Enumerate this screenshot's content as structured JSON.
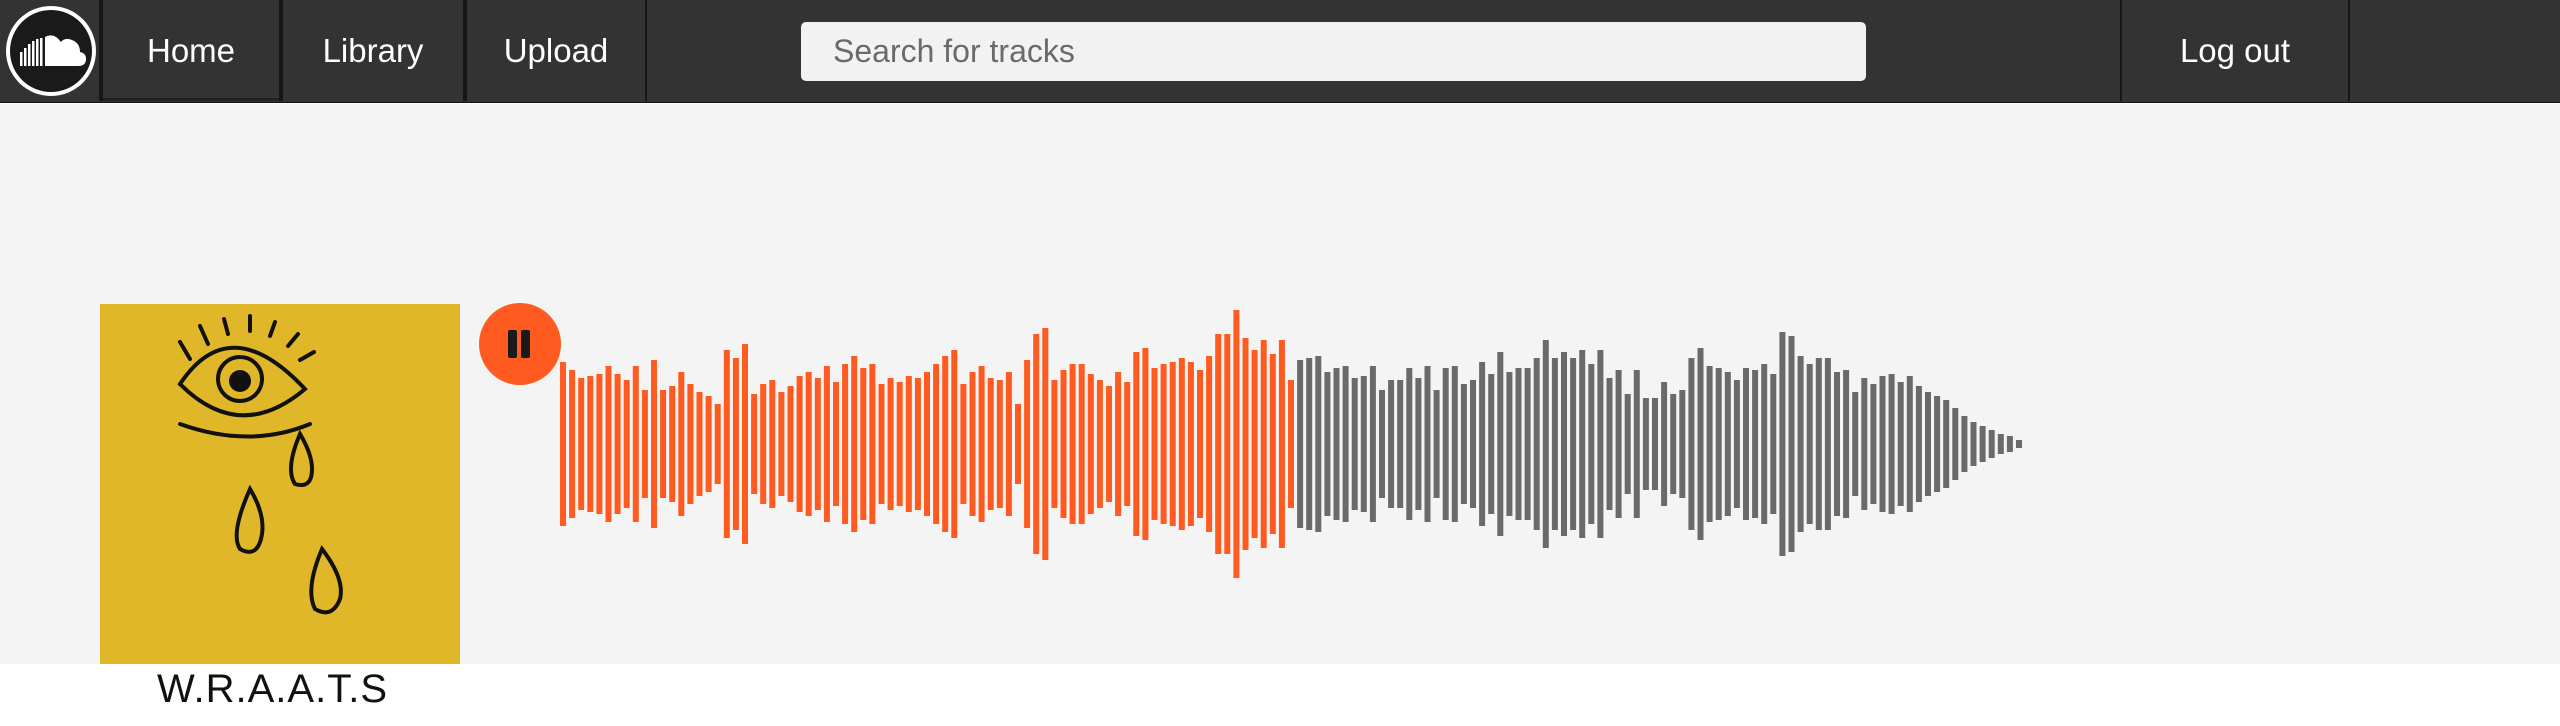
{
  "nav": {
    "logo_icon": "soundcloud-logo-icon",
    "home_label": "Home",
    "library_label": "Library",
    "upload_label": "Upload",
    "search_placeholder": "Search for tracks",
    "logout_label": "Log out"
  },
  "player": {
    "state": "playing",
    "play_button_icon": "pause-icon",
    "cover_art_icon": "crying-eye-icon",
    "track_title": "W.R.A.A.T.S",
    "progress_fraction": 0.503,
    "colors": {
      "played": "#ff5a1f",
      "unplayed": "#6a6a6a",
      "accent": "#ff5a1f",
      "navbar": "#333333"
    },
    "waveform_amplitudes": [
      0.41,
      0.37,
      0.33,
      0.34,
      0.35,
      0.39,
      0.35,
      0.32,
      0.39,
      0.27,
      0.42,
      0.27,
      0.29,
      0.36,
      0.3,
      0.26,
      0.24,
      0.2,
      0.47,
      0.43,
      0.5,
      0.25,
      0.3,
      0.32,
      0.26,
      0.29,
      0.34,
      0.36,
      0.33,
      0.39,
      0.31,
      0.4,
      0.44,
      0.38,
      0.4,
      0.3,
      0.33,
      0.31,
      0.34,
      0.33,
      0.36,
      0.4,
      0.44,
      0.47,
      0.3,
      0.36,
      0.39,
      0.33,
      0.32,
      0.36,
      0.2,
      0.42,
      0.55,
      0.58,
      0.32,
      0.37,
      0.4,
      0.4,
      0.35,
      0.32,
      0.29,
      0.36,
      0.31,
      0.46,
      0.48,
      0.38,
      0.4,
      0.41,
      0.43,
      0.41,
      0.37,
      0.44,
      0.55,
      0.55,
      0.67,
      0.53,
      0.47,
      0.52,
      0.45,
      0.52,
      0.32,
      0.42,
      0.43,
      0.44,
      0.36,
      0.38,
      0.39,
      0.33,
      0.34,
      0.39,
      0.27,
      0.32,
      0.32,
      0.38,
      0.33,
      0.39,
      0.27,
      0.38,
      0.39,
      0.3,
      0.32,
      0.41,
      0.35,
      0.46,
      0.36,
      0.38,
      0.38,
      0.43,
      0.52,
      0.43,
      0.46,
      0.43,
      0.47,
      0.4,
      0.47,
      0.33,
      0.37,
      0.25,
      0.37,
      0.23,
      0.23,
      0.31,
      0.25,
      0.27,
      0.43,
      0.48,
      0.39,
      0.38,
      0.36,
      0.32,
      0.38,
      0.37,
      0.4,
      0.35,
      0.56,
      0.54,
      0.44,
      0.4,
      0.43,
      0.43,
      0.36,
      0.37,
      0.26,
      0.33,
      0.3,
      0.34,
      0.35,
      0.31,
      0.34,
      0.29,
      0.26,
      0.24,
      0.22,
      0.18,
      0.14,
      0.11,
      0.09,
      0.07,
      0.05,
      0.04,
      0.02
    ]
  }
}
